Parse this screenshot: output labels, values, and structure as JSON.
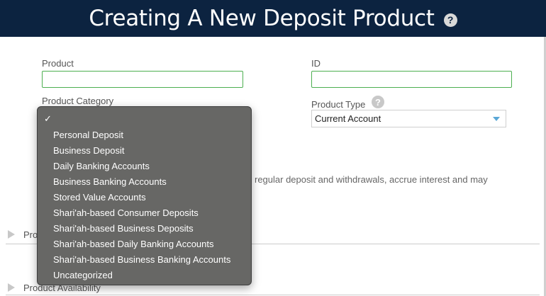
{
  "header": {
    "title": "Creating A New Deposit Product",
    "help_glyph": "?"
  },
  "form": {
    "product_label": "Product",
    "product_value": "",
    "id_label": "ID",
    "id_value": "",
    "category_label": "Product Category",
    "type_label": "Product Type",
    "type_help_glyph": "?",
    "type_selected": "Current Account"
  },
  "description": {
    "text": "regular deposit and withdrawals, accrue interest and may"
  },
  "sections": [
    {
      "label": "Pro"
    },
    {
      "label": "Product Availability"
    }
  ],
  "category_dropdown": {
    "selected_index": 0,
    "items": [
      {
        "label": "",
        "check": "✓"
      },
      {
        "label": "Personal Deposit"
      },
      {
        "label": "Business Deposit"
      },
      {
        "label": "Daily Banking Accounts"
      },
      {
        "label": "Business Banking Accounts"
      },
      {
        "label": "Stored Value Accounts"
      },
      {
        "label": "Shari'ah-based Consumer Deposits"
      },
      {
        "label": "Shari'ah-based Business Deposits"
      },
      {
        "label": "Shari'ah-based Daily Banking Accounts"
      },
      {
        "label": "Shari'ah-based Business Banking Accounts"
      },
      {
        "label": "Uncategorized"
      }
    ]
  },
  "colors": {
    "header_bg": "#0c2340",
    "input_border": "#4caf50",
    "dropdown_bg": "#626260",
    "select_arrow": "#5aa7d6"
  }
}
